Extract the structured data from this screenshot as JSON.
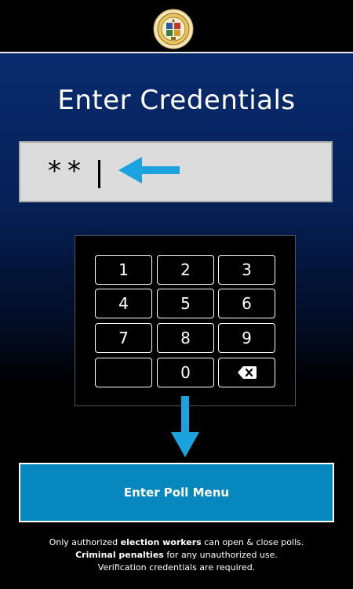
{
  "header": {
    "seal_icon": "county-seal-icon"
  },
  "title": "Enter Credentials",
  "credentials": {
    "masked_value": "**"
  },
  "keypad": {
    "keys": [
      "1",
      "2",
      "3",
      "4",
      "5",
      "6",
      "7",
      "8",
      "9",
      "",
      "0"
    ],
    "backspace_icon": "backspace-icon"
  },
  "enter_button": {
    "label": "Enter Poll Menu"
  },
  "notice": {
    "line1_pre": "Only authorized ",
    "line1_bold": "election workers",
    "line1_post": " can open & close polls.",
    "line2_bold": "Criminal penalties",
    "line2_post": " for any unauthorized use.",
    "line3": "Verification credentials are required."
  },
  "colors": {
    "accent_arrow": "#1ba3e0",
    "button_bg": "#0688bf",
    "background_top": "#0a2b6e"
  }
}
